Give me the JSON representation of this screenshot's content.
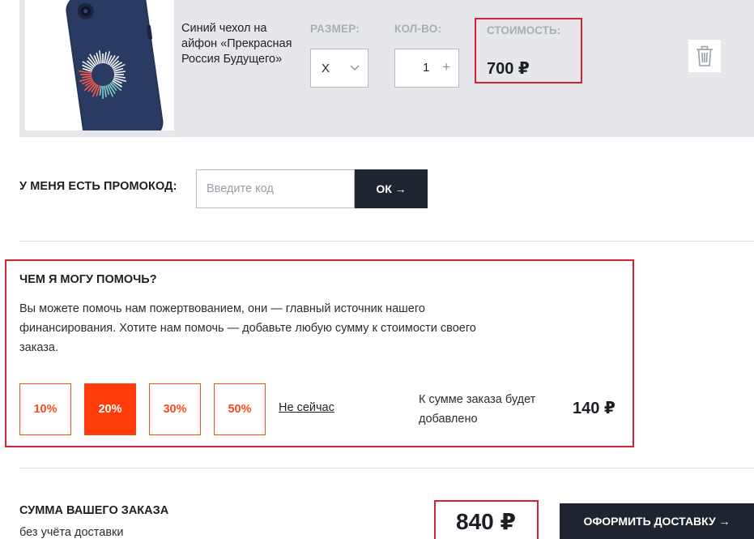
{
  "product": {
    "name": "Синий чехол на айфон «Прекрасная Россия Будущего»",
    "size_label": "РАЗМЕР:",
    "size_value": "X",
    "qty_label": "КОЛ-ВО:",
    "qty_value": "1",
    "qty_plus": "+",
    "price_label": "СТОИМОСТЬ:",
    "price_value": "700 ₽",
    "image_icon": "phone-case-image",
    "delete_icon": "trash-icon"
  },
  "promo": {
    "label": "У МЕНЯ ЕСТЬ ПРОМОКОД:",
    "placeholder": "Введите код",
    "button_label": "ОК →"
  },
  "donate": {
    "title": "ЧЕМ Я МОГУ ПОМОЧЬ?",
    "text": "Вы можете помочь нам пожертвованием, они — главный источник нашего финансирования. Хотите нам помочь — добавьте любую сумму к стоимости своего заказа.",
    "options": [
      "10%",
      "20%",
      "30%",
      "50%"
    ],
    "selected": "20%",
    "not_now": "Не сейчас",
    "added_label": "К сумме заказа будет добавлено",
    "added_value": "140 ₽"
  },
  "total": {
    "title": "СУММА ВАШЕГО ЗАКАЗА",
    "subtitle": "без учёта доставки",
    "value": "840 ₽",
    "checkout_label": "ОФОРМИТЬ ДОСТАВКУ →"
  },
  "colors": {
    "accent": "#ff3c0a",
    "highlight": "#d42234",
    "dark_button": "#1f2530",
    "row_bg": "#e6e7eb",
    "muted_label": "#a9adb6"
  }
}
